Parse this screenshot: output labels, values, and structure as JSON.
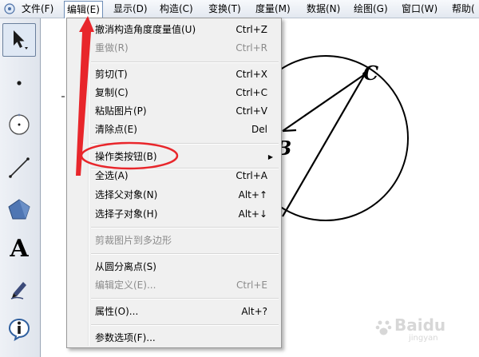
{
  "menubar": {
    "items": [
      {
        "label": "文件(F)"
      },
      {
        "label": "编辑(E)"
      },
      {
        "label": "显示(D)"
      },
      {
        "label": "构造(C)"
      },
      {
        "label": "变换(T)"
      },
      {
        "label": "度量(M)"
      },
      {
        "label": "数据(N)"
      },
      {
        "label": "绘图(G)"
      },
      {
        "label": "窗口(W)"
      },
      {
        "label": "帮助("
      }
    ],
    "active": "编辑(E)"
  },
  "toolbar": {
    "tools": [
      {
        "name": "arrow-select-tool",
        "selected": true
      },
      {
        "name": "point-tool"
      },
      {
        "name": "compass-circle-tool"
      },
      {
        "name": "straightedge-line-tool"
      },
      {
        "name": "polygon-tool"
      },
      {
        "name": "text-tool",
        "glyph": "A"
      },
      {
        "name": "marker-pen-tool"
      },
      {
        "name": "information-tool"
      }
    ]
  },
  "edit_menu": {
    "items": [
      {
        "label": "撤消构造角度度量值(U)",
        "shortcut": "Ctrl+Z",
        "disabled": false
      },
      {
        "label": "重做(R)",
        "shortcut": "Ctrl+R",
        "disabled": true
      },
      {
        "label": "剪切(T)",
        "shortcut": "Ctrl+X",
        "disabled": false
      },
      {
        "label": "复制(C)",
        "shortcut": "Ctrl+C",
        "disabled": false
      },
      {
        "label": "粘贴图片(P)",
        "shortcut": "Ctrl+V",
        "disabled": false
      },
      {
        "label": "清除点(E)",
        "shortcut": "Del",
        "disabled": false
      },
      {
        "label": "操作类按钮(B)",
        "shortcut": "",
        "disabled": false,
        "submenu": true
      },
      {
        "label": "全选(A)",
        "shortcut": "Ctrl+A",
        "disabled": false
      },
      {
        "label": "选择父对象(N)",
        "shortcut": "Alt+↑",
        "disabled": false
      },
      {
        "label": "选择子对象(H)",
        "shortcut": "Alt+↓",
        "disabled": false
      },
      {
        "label": "剪裁图片到多边形",
        "shortcut": "",
        "disabled": true
      },
      {
        "label": "从圆分离点(S)",
        "shortcut": "",
        "disabled": false
      },
      {
        "label": "编辑定义(E)...",
        "shortcut": "Ctrl+E",
        "disabled": true
      },
      {
        "label": "属性(O)...",
        "shortcut": "Alt+?",
        "disabled": false
      },
      {
        "label": "参数选项(F)...",
        "shortcut": "",
        "disabled": false
      }
    ]
  },
  "canvas": {
    "point_c_label": "C",
    "point_b_label": "B"
  },
  "watermark": {
    "brand": "Baidu",
    "sub": "jingyan"
  },
  "colors": {
    "annotation_red": "#e8262b",
    "menubar_active_border": "#6d8db6",
    "menu_background": "#f0f0f0"
  }
}
